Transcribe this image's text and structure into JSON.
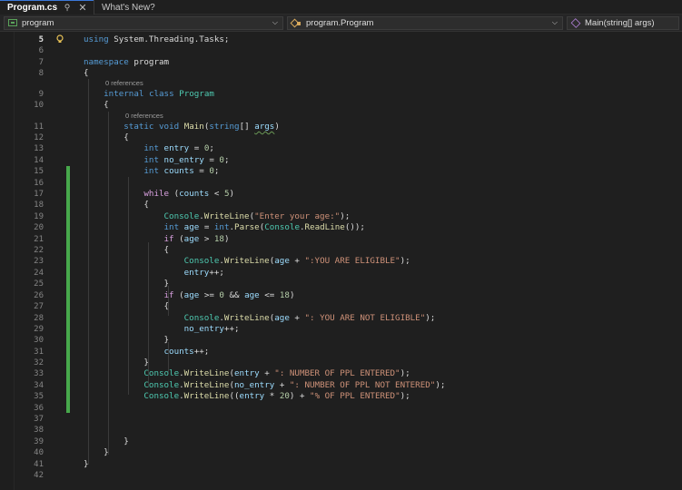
{
  "tabs": [
    {
      "label": "Program.cs",
      "active": true
    },
    {
      "label": "What's New?",
      "active": false
    }
  ],
  "navbar": {
    "project": "program",
    "class": "program.Program",
    "member": "Main(string[] args)"
  },
  "codelens": {
    "class_refs": "0 references",
    "method_refs": "0 references"
  },
  "line_numbers": [
    "5",
    "6",
    "7",
    "8",
    "9",
    "10",
    "11",
    "12",
    "13",
    "14",
    "15",
    "16",
    "17",
    "18",
    "19",
    "20",
    "21",
    "22",
    "23",
    "24",
    "25",
    "26",
    "27",
    "28",
    "29",
    "30",
    "31",
    "32",
    "33",
    "34",
    "35",
    "36",
    "37",
    "38",
    "39",
    "40",
    "41",
    "42"
  ],
  "current_line": "5",
  "code_lines": [
    [
      [
        "kw",
        "using"
      ],
      [
        "pl",
        " System.Threading.Tasks;"
      ]
    ],
    [],
    [
      [
        "kw",
        "namespace"
      ],
      [
        "ns",
        " program"
      ]
    ],
    [
      [
        "pl",
        "{"
      ]
    ],
    [
      [
        "pl",
        "    "
      ],
      [
        "kw",
        "internal"
      ],
      [
        "pl",
        " "
      ],
      [
        "kw",
        "class"
      ],
      [
        "pl",
        " "
      ],
      [
        "ty",
        "Program"
      ]
    ],
    [
      [
        "pl",
        "    {"
      ]
    ],
    [
      [
        "pl",
        "        "
      ],
      [
        "kw",
        "static"
      ],
      [
        "pl",
        " "
      ],
      [
        "kw",
        "void"
      ],
      [
        "pl",
        " "
      ],
      [
        "mt",
        "Main"
      ],
      [
        "pl",
        "("
      ],
      [
        "kw",
        "string"
      ],
      [
        "pl",
        "[] "
      ],
      [
        "var",
        "args"
      ],
      [
        "pl",
        ")"
      ]
    ],
    [
      [
        "pl",
        "        {"
      ]
    ],
    [
      [
        "pl",
        "            "
      ],
      [
        "kw",
        "int"
      ],
      [
        "pl",
        " "
      ],
      [
        "var",
        "entry"
      ],
      [
        "pl",
        " = "
      ],
      [
        "num",
        "0"
      ],
      [
        "pl",
        ";"
      ]
    ],
    [
      [
        "pl",
        "            "
      ],
      [
        "kw",
        "int"
      ],
      [
        "pl",
        " "
      ],
      [
        "var",
        "no_entry"
      ],
      [
        "pl",
        " = "
      ],
      [
        "num",
        "0"
      ],
      [
        "pl",
        ";"
      ]
    ],
    [
      [
        "pl",
        "            "
      ],
      [
        "kw",
        "int"
      ],
      [
        "pl",
        " "
      ],
      [
        "var",
        "counts"
      ],
      [
        "pl",
        " = "
      ],
      [
        "num",
        "0"
      ],
      [
        "pl",
        ";"
      ]
    ],
    [],
    [
      [
        "pl",
        "            "
      ],
      [
        "ctl",
        "while"
      ],
      [
        "pl",
        " ("
      ],
      [
        "var",
        "counts"
      ],
      [
        "pl",
        " < "
      ],
      [
        "num",
        "5"
      ],
      [
        "pl",
        ")"
      ]
    ],
    [
      [
        "pl",
        "            {"
      ]
    ],
    [
      [
        "pl",
        "                "
      ],
      [
        "ty",
        "Console"
      ],
      [
        "pl",
        "."
      ],
      [
        "mt",
        "WriteLine"
      ],
      [
        "pl",
        "("
      ],
      [
        "str",
        "\"Enter your age:\""
      ],
      [
        "pl",
        ");"
      ]
    ],
    [
      [
        "pl",
        "                "
      ],
      [
        "kw",
        "int"
      ],
      [
        "pl",
        " "
      ],
      [
        "var",
        "age"
      ],
      [
        "pl",
        " = "
      ],
      [
        "kw",
        "int"
      ],
      [
        "pl",
        "."
      ],
      [
        "mt",
        "Parse"
      ],
      [
        "pl",
        "("
      ],
      [
        "ty",
        "Console"
      ],
      [
        "pl",
        "."
      ],
      [
        "mt",
        "ReadLine"
      ],
      [
        "pl",
        "());"
      ]
    ],
    [
      [
        "pl",
        "                "
      ],
      [
        "ctl",
        "if"
      ],
      [
        "pl",
        " ("
      ],
      [
        "var",
        "age"
      ],
      [
        "pl",
        " > "
      ],
      [
        "num",
        "18"
      ],
      [
        "pl",
        ")"
      ]
    ],
    [
      [
        "pl",
        "                {"
      ]
    ],
    [
      [
        "pl",
        "                    "
      ],
      [
        "ty",
        "Console"
      ],
      [
        "pl",
        "."
      ],
      [
        "mt",
        "WriteLine"
      ],
      [
        "pl",
        "("
      ],
      [
        "var",
        "age"
      ],
      [
        "pl",
        " + "
      ],
      [
        "str",
        "\":YOU ARE ELIGIBLE\""
      ],
      [
        "pl",
        ");"
      ]
    ],
    [
      [
        "pl",
        "                    "
      ],
      [
        "var",
        "entry"
      ],
      [
        "pl",
        "++;"
      ]
    ],
    [
      [
        "pl",
        "                }"
      ]
    ],
    [
      [
        "pl",
        "                "
      ],
      [
        "ctl",
        "if"
      ],
      [
        "pl",
        " ("
      ],
      [
        "var",
        "age"
      ],
      [
        "pl",
        " >= "
      ],
      [
        "num",
        "0"
      ],
      [
        "pl",
        " && "
      ],
      [
        "var",
        "age"
      ],
      [
        "pl",
        " <= "
      ],
      [
        "num",
        "18"
      ],
      [
        "pl",
        ")"
      ]
    ],
    [
      [
        "pl",
        "                {"
      ]
    ],
    [
      [
        "pl",
        "                    "
      ],
      [
        "ty",
        "Console"
      ],
      [
        "pl",
        "."
      ],
      [
        "mt",
        "WriteLine"
      ],
      [
        "pl",
        "("
      ],
      [
        "var",
        "age"
      ],
      [
        "pl",
        " + "
      ],
      [
        "str",
        "\": YOU ARE NOT ELIGIBLE\""
      ],
      [
        "pl",
        ");"
      ]
    ],
    [
      [
        "pl",
        "                    "
      ],
      [
        "var",
        "no_entry"
      ],
      [
        "pl",
        "++;"
      ]
    ],
    [
      [
        "pl",
        "                }"
      ]
    ],
    [
      [
        "pl",
        "                "
      ],
      [
        "var",
        "counts"
      ],
      [
        "pl",
        "++;"
      ]
    ],
    [
      [
        "pl",
        "            }"
      ]
    ],
    [
      [
        "pl",
        "            "
      ],
      [
        "ty",
        "Console"
      ],
      [
        "pl",
        "."
      ],
      [
        "mt",
        "WriteLine"
      ],
      [
        "pl",
        "("
      ],
      [
        "var",
        "entry"
      ],
      [
        "pl",
        " + "
      ],
      [
        "str",
        "\": NUMBER OF PPL ENTERED\""
      ],
      [
        "pl",
        ");"
      ]
    ],
    [
      [
        "pl",
        "            "
      ],
      [
        "ty",
        "Console"
      ],
      [
        "pl",
        "."
      ],
      [
        "mt",
        "WriteLine"
      ],
      [
        "pl",
        "("
      ],
      [
        "var",
        "no_entry"
      ],
      [
        "pl",
        " + "
      ],
      [
        "str",
        "\": NUMBER OF PPL NOT ENTERED\""
      ],
      [
        "pl",
        ");"
      ]
    ],
    [
      [
        "pl",
        "            "
      ],
      [
        "ty",
        "Console"
      ],
      [
        "pl",
        "."
      ],
      [
        "mt",
        "WriteLine"
      ],
      [
        "pl",
        "(("
      ],
      [
        "var",
        "entry"
      ],
      [
        "pl",
        " * "
      ],
      [
        "num",
        "20"
      ],
      [
        "pl",
        ") + "
      ],
      [
        "str",
        "\"% OF PPL ENTERED\""
      ],
      [
        "pl",
        ");"
      ]
    ],
    [],
    [],
    [],
    [
      [
        "pl",
        "        }"
      ]
    ],
    [
      [
        "pl",
        "    }"
      ]
    ],
    [
      [
        "pl",
        "}"
      ]
    ],
    []
  ]
}
